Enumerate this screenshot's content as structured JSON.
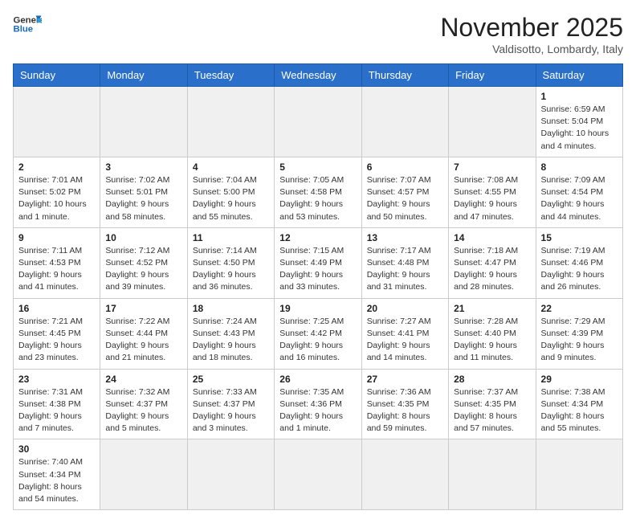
{
  "header": {
    "logo_general": "General",
    "logo_blue": "Blue",
    "month_title": "November 2025",
    "location": "Valdisotto, Lombardy, Italy"
  },
  "days_of_week": [
    "Sunday",
    "Monday",
    "Tuesday",
    "Wednesday",
    "Thursday",
    "Friday",
    "Saturday"
  ],
  "weeks": [
    [
      {
        "day": "",
        "empty": true
      },
      {
        "day": "",
        "empty": true
      },
      {
        "day": "",
        "empty": true
      },
      {
        "day": "",
        "empty": true
      },
      {
        "day": "",
        "empty": true
      },
      {
        "day": "",
        "empty": true
      },
      {
        "day": "1",
        "sunrise": "6:59 AM",
        "sunset": "5:04 PM",
        "daylight": "10 hours and 4 minutes."
      }
    ],
    [
      {
        "day": "2",
        "sunrise": "7:01 AM",
        "sunset": "5:02 PM",
        "daylight": "10 hours and 1 minute."
      },
      {
        "day": "3",
        "sunrise": "7:02 AM",
        "sunset": "5:01 PM",
        "daylight": "9 hours and 58 minutes."
      },
      {
        "day": "4",
        "sunrise": "7:04 AM",
        "sunset": "5:00 PM",
        "daylight": "9 hours and 55 minutes."
      },
      {
        "day": "5",
        "sunrise": "7:05 AM",
        "sunset": "4:58 PM",
        "daylight": "9 hours and 53 minutes."
      },
      {
        "day": "6",
        "sunrise": "7:07 AM",
        "sunset": "4:57 PM",
        "daylight": "9 hours and 50 minutes."
      },
      {
        "day": "7",
        "sunrise": "7:08 AM",
        "sunset": "4:55 PM",
        "daylight": "9 hours and 47 minutes."
      },
      {
        "day": "8",
        "sunrise": "7:09 AM",
        "sunset": "4:54 PM",
        "daylight": "9 hours and 44 minutes."
      }
    ],
    [
      {
        "day": "9",
        "sunrise": "7:11 AM",
        "sunset": "4:53 PM",
        "daylight": "9 hours and 41 minutes."
      },
      {
        "day": "10",
        "sunrise": "7:12 AM",
        "sunset": "4:52 PM",
        "daylight": "9 hours and 39 minutes."
      },
      {
        "day": "11",
        "sunrise": "7:14 AM",
        "sunset": "4:50 PM",
        "daylight": "9 hours and 36 minutes."
      },
      {
        "day": "12",
        "sunrise": "7:15 AM",
        "sunset": "4:49 PM",
        "daylight": "9 hours and 33 minutes."
      },
      {
        "day": "13",
        "sunrise": "7:17 AM",
        "sunset": "4:48 PM",
        "daylight": "9 hours and 31 minutes."
      },
      {
        "day": "14",
        "sunrise": "7:18 AM",
        "sunset": "4:47 PM",
        "daylight": "9 hours and 28 minutes."
      },
      {
        "day": "15",
        "sunrise": "7:19 AM",
        "sunset": "4:46 PM",
        "daylight": "9 hours and 26 minutes."
      }
    ],
    [
      {
        "day": "16",
        "sunrise": "7:21 AM",
        "sunset": "4:45 PM",
        "daylight": "9 hours and 23 minutes."
      },
      {
        "day": "17",
        "sunrise": "7:22 AM",
        "sunset": "4:44 PM",
        "daylight": "9 hours and 21 minutes."
      },
      {
        "day": "18",
        "sunrise": "7:24 AM",
        "sunset": "4:43 PM",
        "daylight": "9 hours and 18 minutes."
      },
      {
        "day": "19",
        "sunrise": "7:25 AM",
        "sunset": "4:42 PM",
        "daylight": "9 hours and 16 minutes."
      },
      {
        "day": "20",
        "sunrise": "7:27 AM",
        "sunset": "4:41 PM",
        "daylight": "9 hours and 14 minutes."
      },
      {
        "day": "21",
        "sunrise": "7:28 AM",
        "sunset": "4:40 PM",
        "daylight": "9 hours and 11 minutes."
      },
      {
        "day": "22",
        "sunrise": "7:29 AM",
        "sunset": "4:39 PM",
        "daylight": "9 hours and 9 minutes."
      }
    ],
    [
      {
        "day": "23",
        "sunrise": "7:31 AM",
        "sunset": "4:38 PM",
        "daylight": "9 hours and 7 minutes."
      },
      {
        "day": "24",
        "sunrise": "7:32 AM",
        "sunset": "4:37 PM",
        "daylight": "9 hours and 5 minutes."
      },
      {
        "day": "25",
        "sunrise": "7:33 AM",
        "sunset": "4:37 PM",
        "daylight": "9 hours and 3 minutes."
      },
      {
        "day": "26",
        "sunrise": "7:35 AM",
        "sunset": "4:36 PM",
        "daylight": "9 hours and 1 minute."
      },
      {
        "day": "27",
        "sunrise": "7:36 AM",
        "sunset": "4:35 PM",
        "daylight": "8 hours and 59 minutes."
      },
      {
        "day": "28",
        "sunrise": "7:37 AM",
        "sunset": "4:35 PM",
        "daylight": "8 hours and 57 minutes."
      },
      {
        "day": "29",
        "sunrise": "7:38 AM",
        "sunset": "4:34 PM",
        "daylight": "8 hours and 55 minutes."
      }
    ],
    [
      {
        "day": "30",
        "sunrise": "7:40 AM",
        "sunset": "4:34 PM",
        "daylight": "8 hours and 54 minutes."
      },
      {
        "day": "",
        "empty": true
      },
      {
        "day": "",
        "empty": true
      },
      {
        "day": "",
        "empty": true
      },
      {
        "day": "",
        "empty": true
      },
      {
        "day": "",
        "empty": true
      },
      {
        "day": "",
        "empty": true
      }
    ]
  ],
  "labels": {
    "sunrise": "Sunrise:",
    "sunset": "Sunset:",
    "daylight": "Daylight:"
  }
}
